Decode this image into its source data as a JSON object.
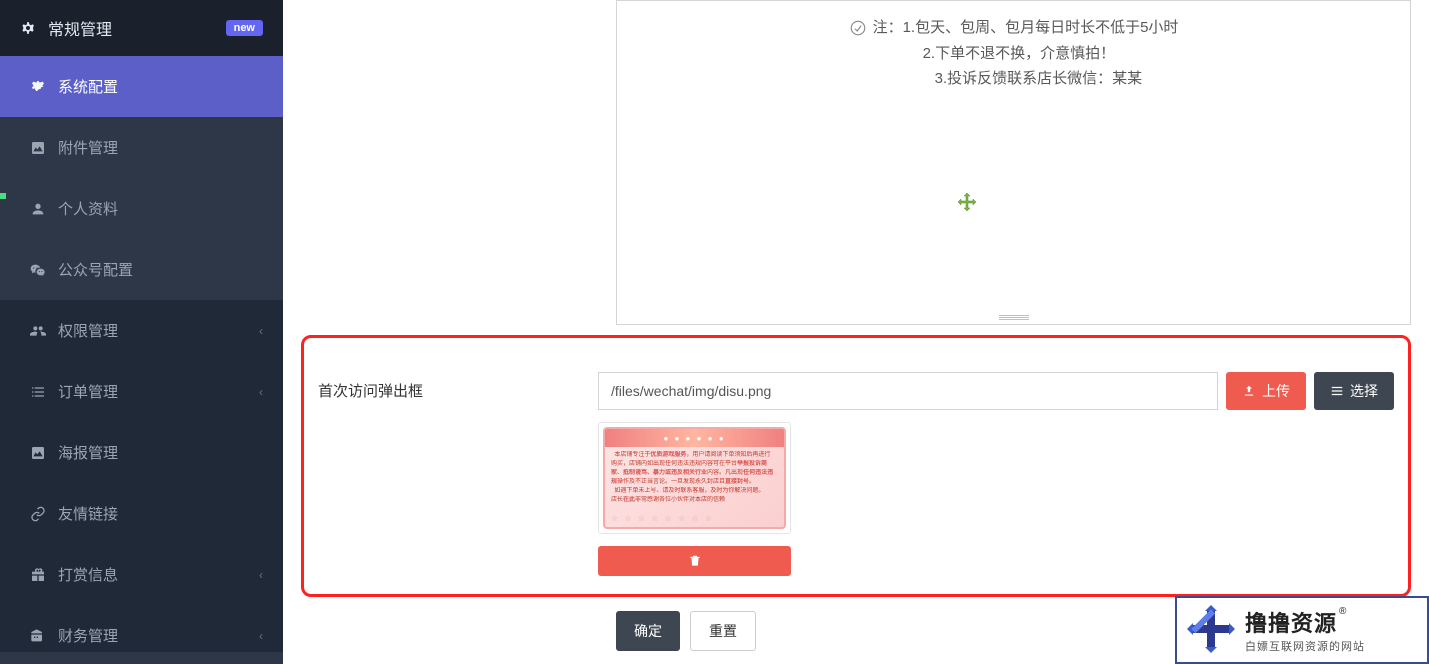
{
  "sidebar": {
    "section_header": {
      "label": "常规管理",
      "badge": "new"
    },
    "items": [
      {
        "label": "系统配置",
        "icon": "gear"
      },
      {
        "label": "附件管理",
        "icon": "image"
      },
      {
        "label": "个人资料",
        "icon": "person"
      },
      {
        "label": "公众号配置",
        "icon": "wechat"
      }
    ],
    "section2": [
      {
        "label": "权限管理",
        "icon": "users"
      },
      {
        "label": "订单管理",
        "icon": "list"
      },
      {
        "label": "海报管理",
        "icon": "image"
      },
      {
        "label": "友情链接",
        "icon": "link"
      },
      {
        "label": "打赏信息",
        "icon": "gift"
      },
      {
        "label": "财务管理",
        "icon": "wallet"
      }
    ]
  },
  "editor": {
    "note_prefix": "注：",
    "line1": "1.包天、包周、包月每日时长不低于5小时",
    "line2": "2.下单不退不换，介意慎拍！",
    "line3": "3.投诉反馈联系店长微信：某某"
  },
  "popup_form": {
    "label": "首次访问弹出框",
    "input_value": "/files/wechat/img/disu.png",
    "upload_label": "上传",
    "select_label": "选择"
  },
  "footer": {
    "confirm": "确定",
    "reset": "重置"
  },
  "brand": {
    "name": "撸撸资源",
    "reg": "®",
    "tagline": "白嫖互联网资源的网站"
  }
}
